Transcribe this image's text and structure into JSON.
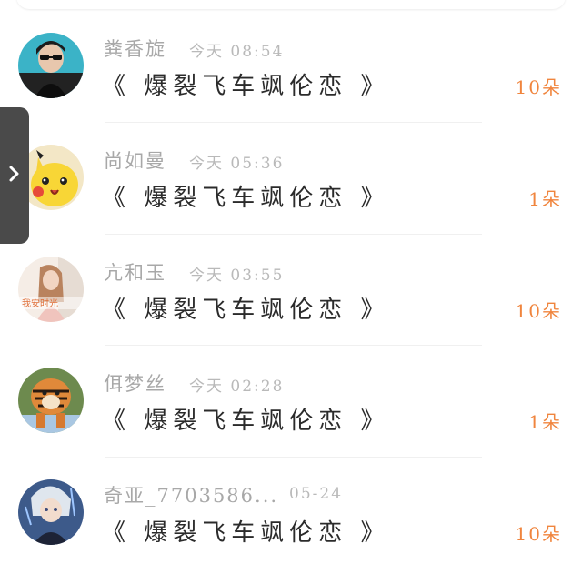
{
  "list": {
    "items": [
      {
        "name": "粪香旋",
        "time": "今天 08:54",
        "title": "《 爆裂飞车飒伦恋 》",
        "amount": "10朵"
      },
      {
        "name": "尚如曼",
        "time": "今天 05:36",
        "title": "《 爆裂飞车飒伦恋 》",
        "amount": "1朵"
      },
      {
        "name": "亢和玉",
        "time": "今天 03:55",
        "title": "《 爆裂飞车飒伦恋 》",
        "amount": "10朵"
      },
      {
        "name": "佴梦丝",
        "time": "今天 02:28",
        "title": "《 爆裂飞车飒伦恋 》",
        "amount": "1朵"
      },
      {
        "name": "奇亚_7703586...",
        "time": "05-24",
        "title": "《 爆裂飞车飒伦恋 》",
        "amount": "10朵"
      }
    ],
    "avatar_3_caption": "我安时光"
  },
  "side_tab": {
    "icon": "chevron-right-icon"
  },
  "colors": {
    "accent": "#f0853e",
    "name": "#a8a8a8",
    "title": "#2b2b2b",
    "tab": "#4a4a4a"
  }
}
